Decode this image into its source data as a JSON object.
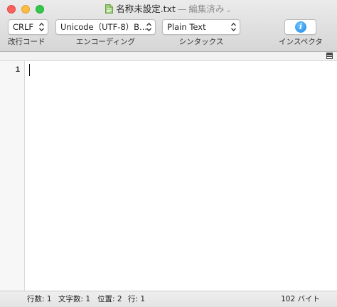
{
  "window": {
    "title": "名称未設定.txt",
    "separator": "—",
    "state": "編集済み",
    "state_chevron": "⌄"
  },
  "toolbar": {
    "line_ending": {
      "value": "CRLF",
      "label": "改行コード"
    },
    "encoding": {
      "value": "Unicode（UTF-8）B...",
      "label": "エンコーディング"
    },
    "syntax": {
      "value": "Plain Text",
      "label": "シンタックス"
    },
    "inspector": {
      "icon": "info-icon",
      "glyph": "i",
      "label": "インスペクタ"
    }
  },
  "editor": {
    "line_numbers": [
      "1"
    ],
    "content": ""
  },
  "status": {
    "lines": "行数: 1",
    "chars": "文字数: 1",
    "location": "位置: 2",
    "line": "行: 1",
    "size": "102 バイト"
  },
  "colors": {
    "close": "#fc605c",
    "minimize": "#fdbc40",
    "maximize": "#34c84a",
    "info_accent": "#1b87e6"
  }
}
